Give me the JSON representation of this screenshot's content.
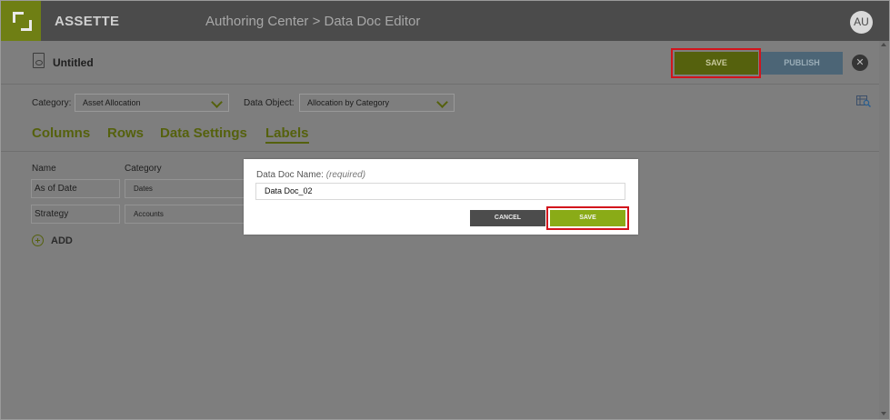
{
  "app": {
    "brand": "ASSETTE",
    "breadcrumb": "Authoring Center > Data Doc Editor",
    "user_initials": "AU"
  },
  "doc": {
    "title": "Untitled",
    "save_label": "SAVE",
    "publish_label": "PUBLISH"
  },
  "filters": {
    "category_label": "Category:",
    "category_value": "Asset Allocation",
    "data_object_label": "Data Object:",
    "data_object_value": "Allocation by Category"
  },
  "tabs": [
    {
      "label": "Columns"
    },
    {
      "label": "Rows"
    },
    {
      "label": "Data Settings"
    },
    {
      "label": "Labels"
    }
  ],
  "labels_table": {
    "headers": [
      "Name",
      "Category"
    ],
    "rows": [
      {
        "name": "As of Date",
        "category": "Dates"
      },
      {
        "name": "Strategy",
        "category": "Accounts"
      }
    ],
    "add_label": "ADD"
  },
  "modal": {
    "field_label": "Data Doc Name:",
    "field_hint": "(required)",
    "field_value": "Data Doc_02",
    "cancel_label": "CANCEL",
    "save_label": "SAVE"
  },
  "colors": {
    "accent": "#8aab17",
    "accent_dim": "#55610d",
    "highlight": "#d2141c"
  },
  "icons": [
    "logo-icon",
    "document-icon",
    "close-icon",
    "chevron-down-icon",
    "table-search-icon",
    "add-circle-icon"
  ]
}
